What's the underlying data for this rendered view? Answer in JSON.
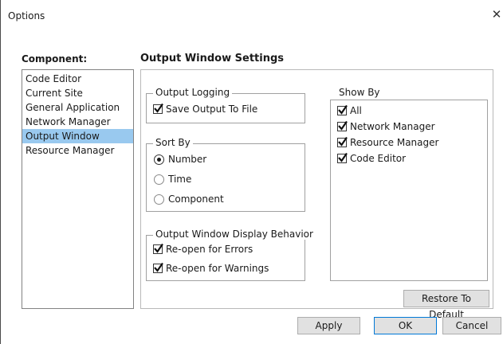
{
  "window": {
    "title": "Options",
    "close_glyph": "✕"
  },
  "component_label": "Component:",
  "settings_title": "Output Window Settings",
  "components": [
    {
      "label": "Code Editor",
      "selected": false
    },
    {
      "label": "Current Site",
      "selected": false
    },
    {
      "label": "General Application",
      "selected": false
    },
    {
      "label": "Network Manager",
      "selected": false
    },
    {
      "label": "Output Window",
      "selected": true
    },
    {
      "label": "Resource Manager",
      "selected": false
    }
  ],
  "output_logging": {
    "legend": "Output Logging",
    "save_output_to_file": {
      "label": "Save Output To File",
      "checked": true
    }
  },
  "sort_by": {
    "legend": "Sort By",
    "options": [
      {
        "label": "Number",
        "selected": true
      },
      {
        "label": "Time",
        "selected": false
      },
      {
        "label": "Component",
        "selected": false
      }
    ]
  },
  "display_behavior": {
    "legend": "Output Window Display Behavior",
    "reopen_errors": {
      "label": "Re-open for Errors",
      "checked": true
    },
    "reopen_warnings": {
      "label": "Re-open for Warnings",
      "checked": true
    }
  },
  "show_by": {
    "legend": "Show By",
    "items": [
      {
        "label": "All",
        "checked": true
      },
      {
        "label": "Network Manager",
        "checked": true
      },
      {
        "label": "Resource Manager",
        "checked": true
      },
      {
        "label": "Code Editor",
        "checked": true
      }
    ]
  },
  "buttons": {
    "restore_prefix": "Restore To ",
    "restore_mnemonic": "D",
    "restore_suffix": "efault",
    "apply": "Apply",
    "ok": "OK",
    "cancel": "Cancel"
  },
  "colors": {
    "selection": "#99c9ef",
    "default_button_border": "#0078d7"
  }
}
